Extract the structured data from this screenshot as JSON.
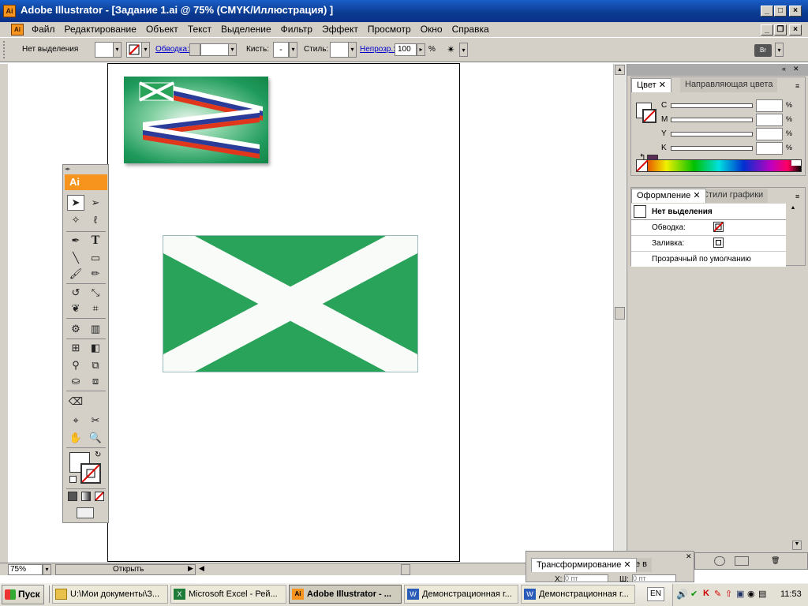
{
  "window": {
    "title": "Adobe Illustrator - [Задание 1.ai @ 75% (CMYK/Иллюстрация) ]",
    "app_icon": "Ai"
  },
  "menu": [
    "Файл",
    "Редактирование",
    "Объект",
    "Текст",
    "Выделение",
    "Фильтр",
    "Эффект",
    "Просмотр",
    "Окно",
    "Справка"
  ],
  "control": {
    "selection": "Нет выделения",
    "stroke_label": "Обводка:",
    "brush_label": "Кисть:",
    "brush_value": "-",
    "style_label": "Стиль:",
    "opacity_label": "Непрозр.:",
    "opacity_value": "100",
    "opacity_unit": "%"
  },
  "status": {
    "zoom": "75%",
    "open_label": "Открыть"
  },
  "tools_header": "Ai",
  "color_panel": {
    "tab_color": "Цвет",
    "tab_guide": "Направляющая цвета",
    "channels": [
      "C",
      "M",
      "Y",
      "K"
    ],
    "unit": "%"
  },
  "appearance_panel": {
    "tab_appearance": "Оформление",
    "tab_styles": "Стили графики",
    "header": "Нет выделения",
    "stroke_label": "Обводка:",
    "fill_label": "Заливка:",
    "opacity_row": "Прозрачный по умолчанию"
  },
  "transform_panel": {
    "tab_transform": "Трансформирование",
    "tab_extra": "е в",
    "x_label": "X:",
    "x_value": "0 пт",
    "w_label": "Ш:",
    "w_value": "0 пт"
  },
  "taskbar": {
    "start": "Пуск",
    "buttons": [
      "U:\\Мои документы\\З...",
      "Microsoft Excel - Рей...",
      "Adobe Illustrator - ...",
      "Демонстрационная г...",
      "Демонстрационная г..."
    ],
    "lang": "EN",
    "clock": "11:53"
  },
  "colors": {
    "flag_green": "#2aa35a",
    "flag_white": "#f8fbf8",
    "accent_orange": "#f7941d"
  }
}
